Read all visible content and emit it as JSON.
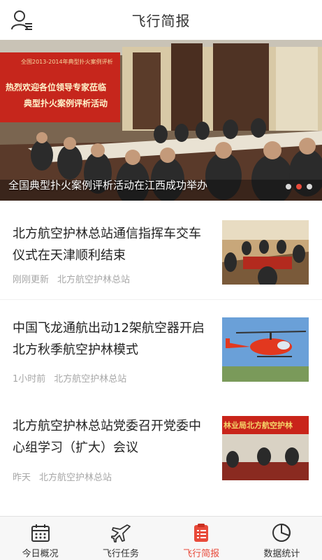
{
  "header": {
    "title": "飞行简报",
    "user_icon": "user-list-icon"
  },
  "banner": {
    "caption": "全国典型扑火案例评析活动在江西成功举办",
    "slide_text_line1": "全国2013-2014年典型扑火案例评析",
    "slide_text_line2": "热烈欢迎各位领导专家莅临",
    "slide_text_line3": "典型扑火案例评析活动",
    "dots": [
      false,
      true,
      false
    ]
  },
  "news": [
    {
      "title": "北方航空护林总站通信指挥车交车仪式在天津顺利结束",
      "time": "刚刚更新",
      "source": "北方航空护林总站"
    },
    {
      "title": "中国飞龙通航出动12架航空器开启北方秋季航空护林模式",
      "time": "1小时前",
      "source": "北方航空护林总站"
    },
    {
      "title": "北方航空护林总站党委召开党委中心组学习（扩大）会议",
      "time": "昨天",
      "source": "北方航空护林总站",
      "thumb_banner": "林业局北方航空护林"
    }
  ],
  "tabs": [
    {
      "label": "今日概况",
      "icon": "calendar-icon",
      "active": false
    },
    {
      "label": "飞行任务",
      "icon": "airplane-icon",
      "active": false
    },
    {
      "label": "飞行简报",
      "icon": "report-icon",
      "active": true
    },
    {
      "label": "数据统计",
      "icon": "pie-chart-icon",
      "active": false
    }
  ],
  "colors": {
    "accent": "#e84a3a",
    "meta_text": "#a7a7a7"
  }
}
